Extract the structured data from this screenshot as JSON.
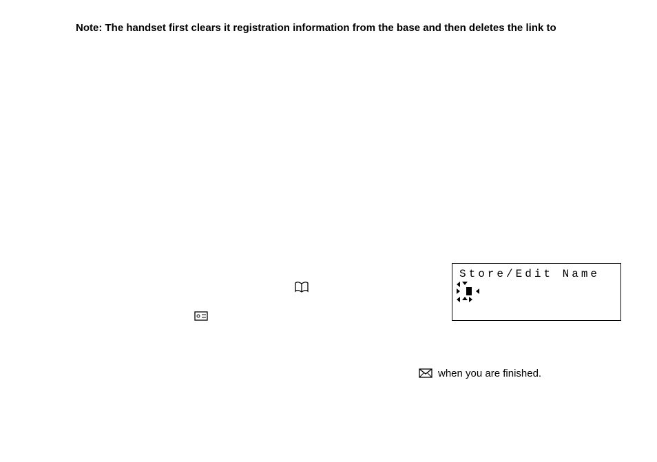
{
  "note_text": "Note: The handset first clears it registration information from the base and then deletes the link to",
  "lcd": {
    "line1": "Store/Edit Name"
  },
  "finished_text": "when you are finished.",
  "icons": {
    "book": "phonebook-icon",
    "envelope1": "caller-id-icon",
    "envelope2": "caller-id-icon"
  }
}
